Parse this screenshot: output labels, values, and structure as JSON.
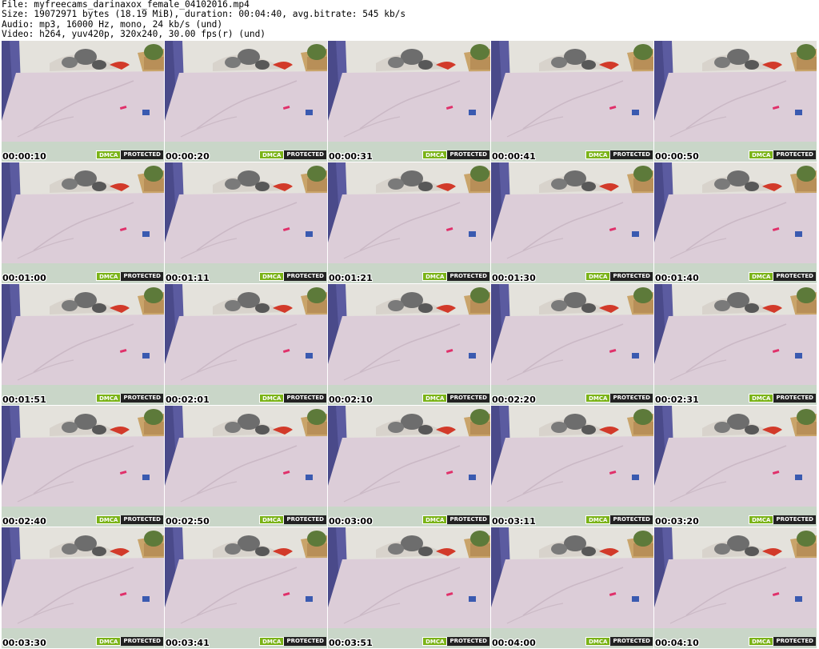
{
  "header": {
    "file_line": "File: myfreecams_darinaxox_female_04102016.mp4",
    "size_line": "Size: 19072971 bytes (18.19 MiB), duration: 00:04:40, avg.bitrate: 545 kb/s",
    "audio_line": "Audio: mp3, 16000 Hz, mono, 24 kb/s (und)",
    "video_line": "Video: h264, yuv420p, 320x240, 30.00 fps(r) (und)"
  },
  "badge": {
    "dmca": "DMCA",
    "protected": "PROTECTED"
  },
  "thumbnails": [
    "00:00:10",
    "00:00:20",
    "00:00:31",
    "00:00:41",
    "00:00:50",
    "00:01:00",
    "00:01:11",
    "00:01:21",
    "00:01:30",
    "00:01:40",
    "00:01:51",
    "00:02:01",
    "00:02:10",
    "00:02:20",
    "00:02:31",
    "00:02:40",
    "00:02:50",
    "00:03:00",
    "00:03:11",
    "00:03:20",
    "00:03:30",
    "00:03:41",
    "00:03:51",
    "00:04:00",
    "00:04:10"
  ]
}
